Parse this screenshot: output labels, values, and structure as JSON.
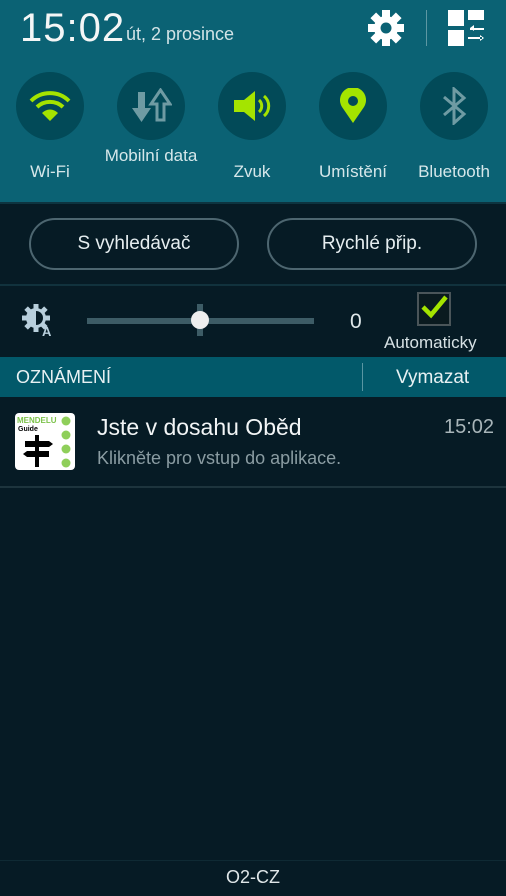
{
  "status": {
    "time": "15:02",
    "date": "út, 2 prosince"
  },
  "header_icons": [
    "gear-icon",
    "grid-edit-icon"
  ],
  "toggles": [
    {
      "label": "Wi-Fi",
      "icon": "wifi-icon",
      "active": true
    },
    {
      "label": "Mobilní data",
      "icon": "mobile-data-icon",
      "active": false
    },
    {
      "label": "Zvuk",
      "icon": "speaker-icon",
      "active": true
    },
    {
      "label": "Umístění",
      "icon": "location-icon",
      "active": true
    },
    {
      "label": "Bluetooth",
      "icon": "bluetooth-icon",
      "active": false
    }
  ],
  "buttons": {
    "finder": "S vyhledávač",
    "quick_connect": "Rychlé přip."
  },
  "brightness": {
    "value": "0",
    "level_percent": 50,
    "auto_label": "Automaticky",
    "auto_checked": true
  },
  "notifications": {
    "header": "OZNÁMENÍ",
    "clear": "Vymazat",
    "items": [
      {
        "app": "MENDELU Guide",
        "title": "Jste v dosahu Oběd",
        "text": "Klikněte pro vstup do aplikace.",
        "time": "15:02"
      }
    ]
  },
  "carrier": "O2-CZ",
  "colors": {
    "accent": "#a4e400",
    "panel": "#0b6274",
    "background": "#061b25"
  }
}
